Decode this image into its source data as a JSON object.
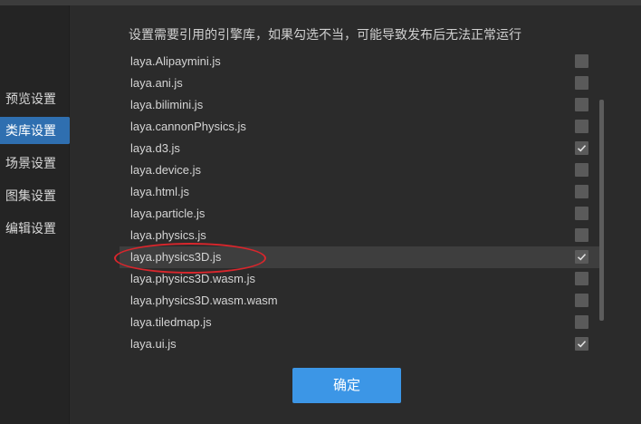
{
  "sidebar": {
    "items": [
      {
        "label": "预览设置",
        "active": false
      },
      {
        "label": "类库设置",
        "active": true
      },
      {
        "label": "场景设置",
        "active": false
      },
      {
        "label": "图集设置",
        "active": false
      },
      {
        "label": "编辑设置",
        "active": false
      }
    ]
  },
  "main": {
    "hint": "设置需要引用的引擎库，如果勾选不当，可能导致发布后无法正常运行",
    "libraries": [
      {
        "name": "laya.Alipaymini.js",
        "checked": false
      },
      {
        "name": "laya.ani.js",
        "checked": false
      },
      {
        "name": "laya.bilimini.js",
        "checked": false
      },
      {
        "name": "laya.cannonPhysics.js",
        "checked": false
      },
      {
        "name": "laya.d3.js",
        "checked": true
      },
      {
        "name": "laya.device.js",
        "checked": false
      },
      {
        "name": "laya.html.js",
        "checked": false
      },
      {
        "name": "laya.particle.js",
        "checked": false
      },
      {
        "name": "laya.physics.js",
        "checked": false
      },
      {
        "name": "laya.physics3D.js",
        "checked": true,
        "selected": true
      },
      {
        "name": "laya.physics3D.wasm.js",
        "checked": false
      },
      {
        "name": "laya.physics3D.wasm.wasm",
        "checked": false
      },
      {
        "name": "laya.tiledmap.js",
        "checked": false
      },
      {
        "name": "laya.ui.js",
        "checked": true
      }
    ],
    "ok_label": "确定"
  },
  "colors": {
    "accent": "#2f6fb0",
    "button": "#3c96e6",
    "annotation": "#d8262c"
  }
}
